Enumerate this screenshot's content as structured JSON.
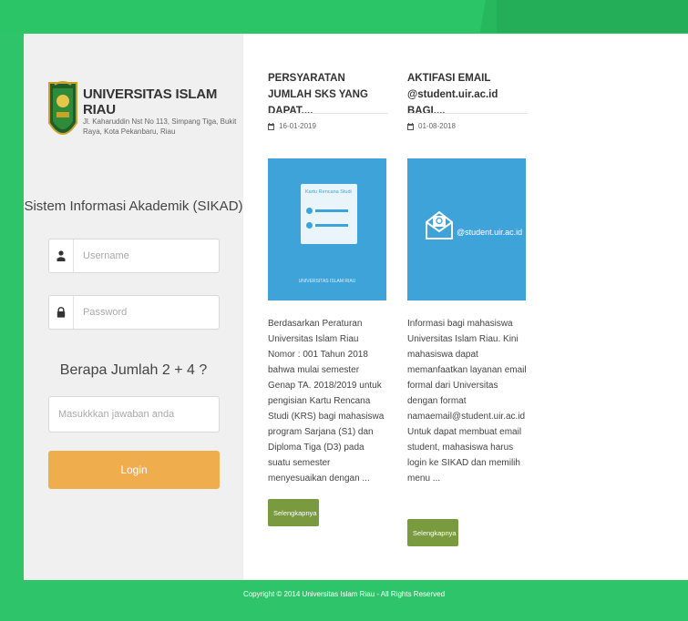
{
  "university": {
    "name": "UNIVERSITAS ISLAM RIAU",
    "address": "Jl. Kaharuddin Nst No 113, Simpang Tiga, Bukit Raya, Kota Pekanbaru, Riau"
  },
  "login": {
    "system_title": "Sistem Informasi Akademik (SIKAD)",
    "username_placeholder": "Username",
    "password_placeholder": "Password",
    "captcha_question": "Berapa Jumlah 2 + 4 ?",
    "answer_placeholder": "Masukkkan jawaban anda",
    "login_label": "Login"
  },
  "news": [
    {
      "title": "PERSYARATAN JUMLAH SKS YANG DAPAT....",
      "date": "16-01-2019",
      "image_caption": "Kartu Rencana Studi",
      "image_footer": "UNIVERSITAS ISLAM RIAU",
      "body": "Berdasarkan Peraturan Universitas Islam Riau Nomor : 001 Tahun 2018 bahwa mulai semester Genap TA. 2018/2019 untuk pengisian Kartu Rencana Studi (KRS) bagi mahasiswa program Sarjana (S1) dan Diploma Tiga (D3) pada suatu semester menyesuaikan dengan ...",
      "more_label": "Selengkapnya"
    },
    {
      "title": "AKTIFASI EMAIL @student.uir.ac.id BAGI....",
      "date": "01-08-2018",
      "image_caption": "@student.uir.ac.id",
      "body": "Informasi bagi mahasiswa Universitas Islam Riau. Kini mahasiswa dapat memanfaatkan layanan email formal dari Universitas dengan format namaemail@student.uir.ac.id Untuk dapat membuat email student, mahasiswa harus login ke SIKAD dan memilih menu ...",
      "more_label": "Selengkapnya"
    }
  ],
  "footer": {
    "copyright": "Copyright © 2014 Universitas Islam Riau - All Rights Reserved"
  },
  "colors": {
    "brand_green": "#2ec46a",
    "login_orange": "#f0ad4e",
    "more_green": "#7a9a3f",
    "card_blue": "#3ea3d9"
  }
}
